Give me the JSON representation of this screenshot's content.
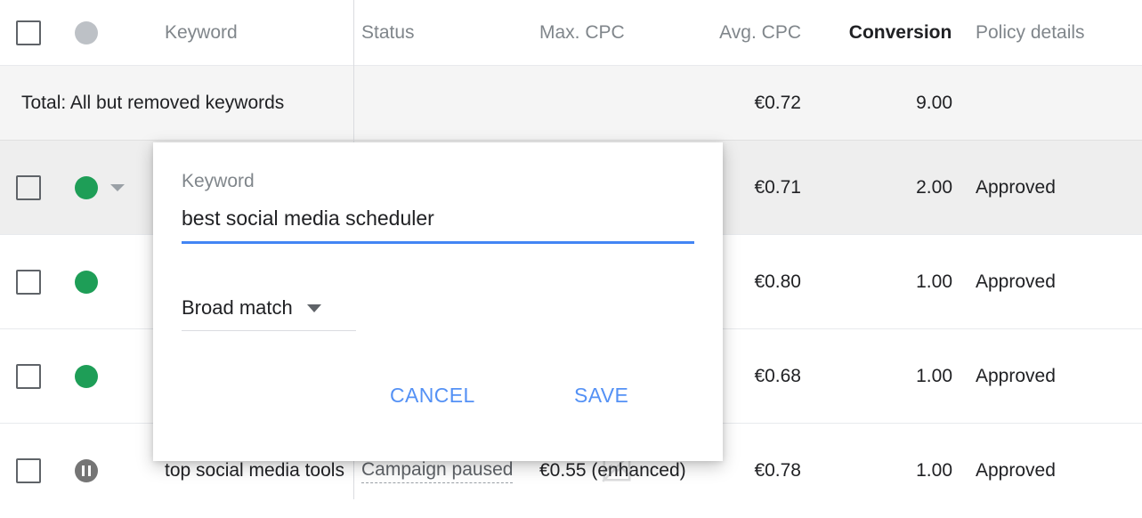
{
  "table": {
    "columns": [
      {
        "key": "checkbox",
        "label": "",
        "icon": "select-all-checkbox"
      },
      {
        "key": "status",
        "label": "",
        "icon": "status-dot"
      },
      {
        "key": "keyword",
        "label": "Keyword"
      },
      {
        "key": "state",
        "label": "Status"
      },
      {
        "key": "max_cpc",
        "label": "Max. CPC"
      },
      {
        "key": "avg_cpc",
        "label": "Avg. CPC"
      },
      {
        "key": "conversions",
        "label": "Conversions",
        "sorted": true
      },
      {
        "key": "policy_details",
        "label": "Policy details"
      }
    ],
    "total_row": {
      "label": "Total: All but removed keywords",
      "max_cpc": "",
      "avg_cpc": "€0.72",
      "conversions": "9.00",
      "policy_details": ""
    },
    "rows": [
      {
        "status_icon": "enabled-green-dot",
        "has_caret": true,
        "selected": true,
        "keyword": "",
        "state": "",
        "max_cpc": "",
        "avg_cpc": "€0.71",
        "conversions": "2.00",
        "policy_details": "Approved"
      },
      {
        "status_icon": "enabled-green-dot",
        "has_caret": false,
        "selected": false,
        "keyword": "",
        "state": "",
        "max_cpc": "",
        "avg_cpc": "€0.80",
        "conversions": "1.00",
        "policy_details": "Approved"
      },
      {
        "status_icon": "enabled-green-dot",
        "has_caret": false,
        "selected": false,
        "keyword": "",
        "state": "",
        "max_cpc": "",
        "avg_cpc": "€0.68",
        "conversions": "1.00",
        "policy_details": "Approved"
      },
      {
        "status_icon": "paused-dot",
        "has_caret": false,
        "selected": false,
        "keyword": "top social media tools",
        "state": "Campaign paused",
        "max_cpc": "€0.55 (enhanced)",
        "avg_cpc": "€0.78",
        "conversions": "1.00",
        "policy_details": "Approved"
      }
    ]
  },
  "dialog": {
    "field_label": "Keyword",
    "keyword_value": "best social media scheduler",
    "keyword_placeholder": "Keyword",
    "match_type": "Broad match",
    "cancel_label": "CANCEL",
    "save_label": "SAVE"
  },
  "colors": {
    "accent_blue": "#4285f4",
    "button_blue": "#5491f5",
    "enabled_green": "#1e9e57",
    "paused_grey": "#757575",
    "header_grey": "#80868b",
    "selected_row": "#eeeeee",
    "total_row": "#f5f5f5"
  }
}
